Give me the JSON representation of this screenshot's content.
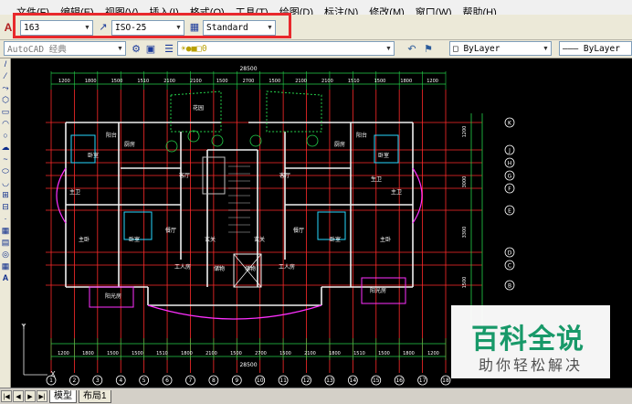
{
  "menu": [
    "文件(F)",
    "编辑(E)",
    "视图(V)",
    "插入(I)",
    "格式(O)",
    "工具(T)",
    "绘图(D)",
    "标注(N)",
    "修改(M)",
    "窗口(W)",
    "帮助(H)"
  ],
  "toolbar": {
    "text_style_value": "163",
    "dim_style_value": "ISO-25",
    "table_style_value": "Standard",
    "workspace_value": "AutoCAD 经典",
    "layer_color_value": "ByLayer",
    "linetype_value": "ByLayer"
  },
  "drawing": {
    "top_total": "28500",
    "bottom_total": "28500",
    "top_dims": [
      "1200",
      "1800",
      "1500",
      "1510",
      "2100",
      "2100",
      "1500",
      "2700",
      "1500",
      "2100",
      "2100",
      "1510",
      "1500",
      "1800",
      "1200"
    ],
    "bottom_dims": [
      "1200",
      "1800",
      "1500",
      "1500",
      "1510",
      "1800",
      "2100",
      "1500",
      "2700",
      "1500",
      "2100",
      "1800",
      "1510",
      "1500",
      "1800",
      "1200"
    ],
    "col_axes": [
      "1",
      "2",
      "3",
      "4",
      "5",
      "6",
      "7",
      "8",
      "9",
      "10",
      "11",
      "12",
      "13",
      "14",
      "15",
      "16",
      "17",
      "18"
    ],
    "row_axes": [
      "K",
      "J",
      "H",
      "G",
      "F",
      "E",
      "D",
      "C",
      "B"
    ],
    "right_dims": [
      "1200",
      "3000",
      "3300",
      "1500"
    ],
    "rooms": [
      "厨房",
      "阳台",
      "卧室",
      "主卫",
      "客厅",
      "餐厅",
      "主卧",
      "卧室",
      "玄关",
      "工人房",
      "储物",
      "阳光房",
      "厨房",
      "阳台",
      "卧室",
      "主卫",
      "客厅",
      "餐厅",
      "主卧",
      "卧室",
      "玄关",
      "工人房",
      "储物",
      "阳光房",
      "花园",
      "生卫"
    ]
  },
  "tabs": {
    "model": "模型",
    "layout1": "布局1"
  },
  "watermark": {
    "title": "百科全说",
    "subtitle": "助你轻松解决"
  }
}
